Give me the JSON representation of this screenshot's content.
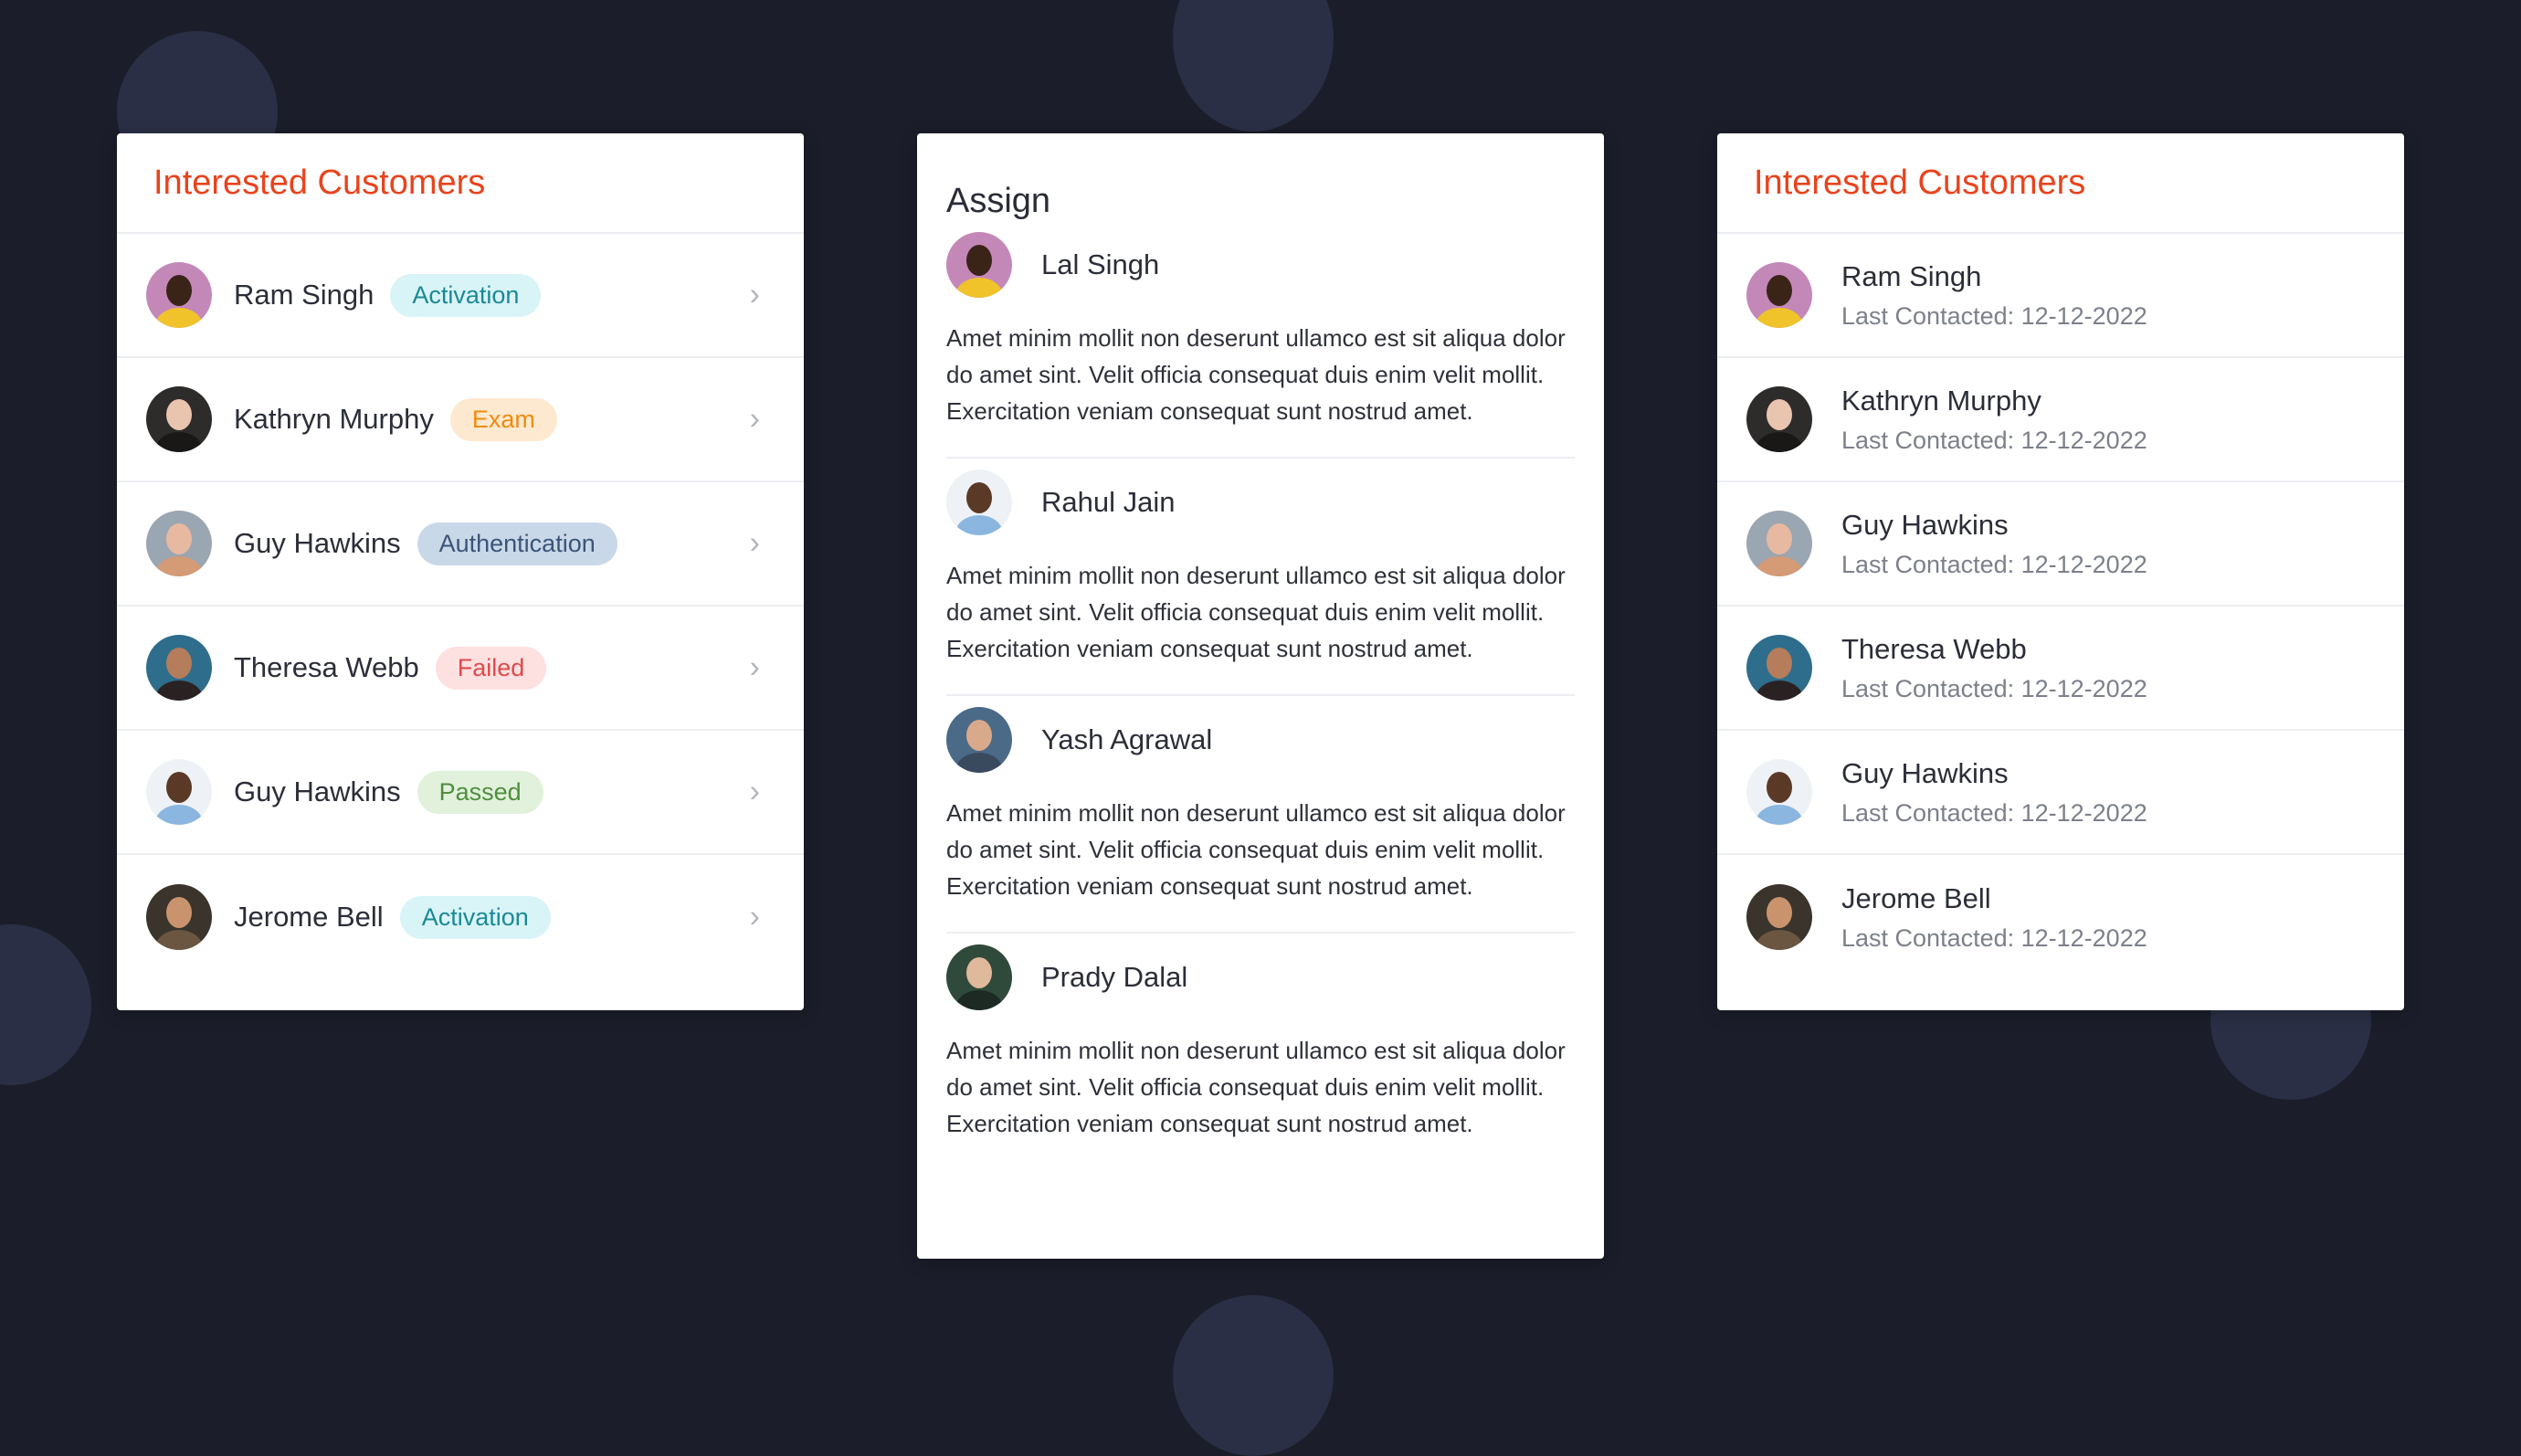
{
  "colors": {
    "background": "#1b1e2a",
    "accent_title": "#e8431d",
    "card": "#ffffff"
  },
  "left_card": {
    "title": "Interested Customers",
    "rows": [
      {
        "name": "Ram Singh",
        "badge": "Activation",
        "badge_bg": "#d9f4f7",
        "badge_fg": "#1b8a96",
        "avatar_bg": "#c488b8",
        "face": "#3a2418",
        "shirt": "#f0c32a"
      },
      {
        "name": "Kathryn Murphy",
        "badge": "Exam",
        "badge_bg": "#fde9cf",
        "badge_fg": "#f08a0f",
        "avatar_bg": "#2e2b2b",
        "face": "#e9c5b0",
        "shirt": "#1a1717"
      },
      {
        "name": "Guy Hawkins",
        "badge": "Authentication",
        "badge_bg": "#c9d8e8",
        "badge_fg": "#3b5478",
        "avatar_bg": "#9aa6b2",
        "face": "#e7b9a1",
        "shirt": "#d59a76"
      },
      {
        "name": "Theresa Webb",
        "badge": "Failed",
        "badge_bg": "#fde0e0",
        "badge_fg": "#e0494b",
        "avatar_bg": "#2f6d8c",
        "face": "#b57d5b",
        "shirt": "#2a2222"
      },
      {
        "name": "Guy Hawkins",
        "badge": "Passed",
        "badge_bg": "#e1f1dc",
        "badge_fg": "#4f8e3c",
        "avatar_bg": "#eef2f6",
        "face": "#5a3a27",
        "shirt": "#8ab6e0"
      },
      {
        "name": "Jerome Bell",
        "badge": "Activation",
        "badge_bg": "#d9f4f7",
        "badge_fg": "#1b8a96",
        "avatar_bg": "#3a342c",
        "face": "#c9946d",
        "shirt": "#6b5642"
      }
    ]
  },
  "mid_card": {
    "title": "Assign",
    "items": [
      {
        "name": "Lal Singh",
        "text": "Amet minim mollit non deserunt ullamco est sit aliqua dolor do amet sint. Velit officia consequat duis enim velit mollit. Exercitation veniam consequat sunt nostrud amet.",
        "avatar_bg": "#c488b8",
        "face": "#3a2418",
        "shirt": "#f0c32a"
      },
      {
        "name": "Rahul Jain",
        "text": "Amet minim mollit non deserunt ullamco est sit aliqua dolor do amet sint. Velit officia consequat duis enim velit mollit. Exercitation veniam consequat sunt nostrud amet.",
        "avatar_bg": "#eef2f6",
        "face": "#5a3a27",
        "shirt": "#8ab6e0"
      },
      {
        "name": "Yash Agrawal",
        "text": "Amet minim mollit non deserunt ullamco est sit aliqua dolor do amet sint. Velit officia consequat duis enim velit mollit. Exercitation veniam consequat sunt nostrud amet.",
        "avatar_bg": "#4a6a88",
        "face": "#d8a98a",
        "shirt": "#3a4a5e"
      },
      {
        "name": "Prady Dalal",
        "text": "Amet minim mollit non deserunt ullamco est sit aliqua dolor do amet sint. Velit officia consequat duis enim velit mollit. Exercitation veniam consequat sunt nostrud amet.",
        "avatar_bg": "#2f4a3a",
        "face": "#e0b89c",
        "shirt": "#1d2a24"
      }
    ]
  },
  "right_card": {
    "title": "Interested Customers",
    "rows": [
      {
        "name": "Ram Singh",
        "sub": "Last Contacted: 12-12-2022",
        "avatar_bg": "#c488b8",
        "face": "#3a2418",
        "shirt": "#f0c32a"
      },
      {
        "name": "Kathryn Murphy",
        "sub": "Last Contacted: 12-12-2022",
        "avatar_bg": "#2e2b2b",
        "face": "#e9c5b0",
        "shirt": "#1a1717"
      },
      {
        "name": "Guy Hawkins",
        "sub": "Last Contacted: 12-12-2022",
        "avatar_bg": "#9aa6b2",
        "face": "#e7b9a1",
        "shirt": "#d59a76"
      },
      {
        "name": "Theresa Webb",
        "sub": "Last Contacted: 12-12-2022",
        "avatar_bg": "#2f6d8c",
        "face": "#b57d5b",
        "shirt": "#2a2222"
      },
      {
        "name": "Guy Hawkins",
        "sub": "Last Contacted: 12-12-2022",
        "avatar_bg": "#eef2f6",
        "face": "#5a3a27",
        "shirt": "#8ab6e0"
      },
      {
        "name": "Jerome Bell",
        "sub": "Last Contacted: 12-12-2022",
        "avatar_bg": "#3a342c",
        "face": "#c9946d",
        "shirt": "#6b5642"
      }
    ]
  }
}
